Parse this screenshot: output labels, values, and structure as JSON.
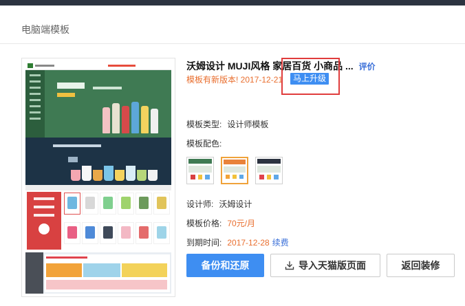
{
  "section_title": "电脑端模板",
  "template": {
    "title": "沃姆设计 MUJI风格 家居百货 小商品 ...",
    "review_link": "评价",
    "new_version_notice": "模板有新版本! 2017-12-21",
    "upgrade_button": "马上升级",
    "type_label": "模板类型:",
    "type_value": "设计师模板",
    "color_label": "模板配色:",
    "designer_label": "设计师:",
    "designer_value": "沃姆设计",
    "price_label": "模板价格:",
    "price_value": "70元/月",
    "expire_label": "到期时间:",
    "expire_value": "2017-12-28",
    "renew_link": "续费"
  },
  "color_schemes": [
    {
      "name": "green",
      "header": "#3f7a53",
      "accent": "#d84141",
      "selected": false
    },
    {
      "name": "orange",
      "header": "#e9823a",
      "accent": "#f2a33a",
      "selected": true
    },
    {
      "name": "dark",
      "header": "#2c3340",
      "accent": "#e0434d",
      "selected": false
    }
  ],
  "actions": {
    "backup_button": "备份和还原",
    "import_button": "导入天猫版页面",
    "back_button": "返回装修"
  },
  "colors": {
    "primary": "#3e8ef2",
    "warning": "#e96e2e",
    "link": "#3a6fd8",
    "highlight": "#e03c3c"
  },
  "icons": {
    "import": "import-icon"
  }
}
